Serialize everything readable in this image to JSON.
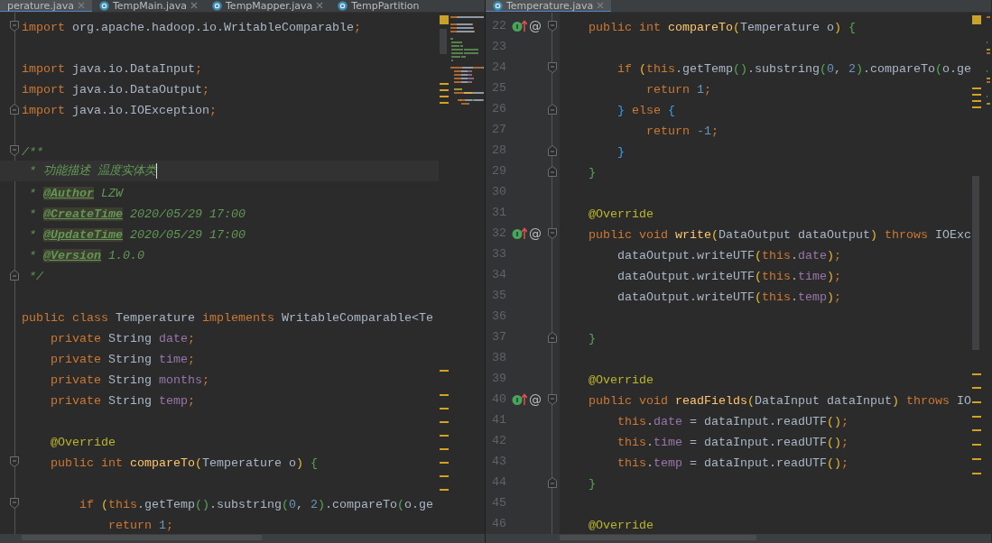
{
  "left_editor": {
    "tabs": [
      {
        "label": "perature.java",
        "selected": true,
        "icon": false,
        "closable": true
      },
      {
        "label": "TempMain.java",
        "selected": false,
        "icon": true,
        "closable": true
      },
      {
        "label": "TempMapper.java",
        "selected": false,
        "icon": true,
        "closable": true
      },
      {
        "label": "TempPartition",
        "selected": false,
        "icon": true,
        "closable": false
      }
    ],
    "lines": [
      {
        "current": false,
        "fold_start": true,
        "fold_end": false,
        "tokens": [
          {
            "text": "import ",
            "kind": "kw"
          },
          {
            "text": "org.apache.hadoop.io.WritableComparable",
            "kind": "plain"
          },
          {
            "text": ";",
            "kind": "kw"
          }
        ]
      },
      {
        "current": false,
        "fold_start": false,
        "fold_end": false
      },
      {
        "current": false,
        "fold_start": false,
        "fold_end": false,
        "tokens": [
          {
            "text": "import ",
            "kind": "kw"
          },
          {
            "text": "java.io.DataInput",
            "kind": "plain"
          },
          {
            "text": ";",
            "kind": "kw"
          }
        ]
      },
      {
        "current": false,
        "fold_start": false,
        "fold_end": false,
        "tokens": [
          {
            "text": "import ",
            "kind": "kw"
          },
          {
            "text": "java.io.DataOutput",
            "kind": "plain"
          },
          {
            "text": ";",
            "kind": "kw"
          }
        ]
      },
      {
        "current": false,
        "fold_start": false,
        "fold_end": true,
        "tokens": [
          {
            "text": "import ",
            "kind": "kw"
          },
          {
            "text": "java.io.IOException",
            "kind": "plain"
          },
          {
            "text": ";",
            "kind": "kw"
          }
        ]
      },
      {
        "current": false,
        "fold_start": false,
        "fold_end": false
      },
      {
        "current": false,
        "fold_start": true,
        "fold_end": false,
        "tokens": [
          {
            "text": "/**",
            "kind": "comment"
          }
        ]
      },
      {
        "current": true,
        "fold_start": false,
        "fold_end": false,
        "tokens": [
          {
            "text": " * 功能描述 温度实体类",
            "kind": "comment"
          }
        ]
      },
      {
        "current": false,
        "fold_start": false,
        "fold_end": false,
        "tokens": [
          {
            "text": " * ",
            "kind": "comment"
          },
          {
            "text": "@Author",
            "kind": "doctag"
          },
          {
            "text": " LZW",
            "kind": "comment"
          }
        ]
      },
      {
        "current": false,
        "fold_start": false,
        "fold_end": false,
        "tokens": [
          {
            "text": " * ",
            "kind": "comment"
          },
          {
            "text": "@CreateTime",
            "kind": "doctag"
          },
          {
            "text": " 2020/05/29 17:00",
            "kind": "comment"
          }
        ]
      },
      {
        "current": false,
        "fold_start": false,
        "fold_end": false,
        "tokens": [
          {
            "text": " * ",
            "kind": "comment"
          },
          {
            "text": "@UpdateTime",
            "kind": "doctag"
          },
          {
            "text": " 2020/05/29 17:00",
            "kind": "comment"
          }
        ]
      },
      {
        "current": false,
        "fold_start": false,
        "fold_end": false,
        "tokens": [
          {
            "text": " * ",
            "kind": "comment"
          },
          {
            "text": "@Version",
            "kind": "doctag"
          },
          {
            "text": " 1.0.0",
            "kind": "comment"
          }
        ]
      },
      {
        "current": false,
        "fold_start": false,
        "fold_end": true,
        "tokens": [
          {
            "text": " */",
            "kind": "comment"
          }
        ]
      },
      {
        "current": false,
        "fold_start": false,
        "fold_end": false
      },
      {
        "current": false,
        "fold_start": false,
        "fold_end": false,
        "tokens": [
          {
            "text": "public class ",
            "kind": "kw"
          },
          {
            "text": "Temperature ",
            "kind": "plain"
          },
          {
            "text": "implements ",
            "kind": "kw"
          },
          {
            "text": "WritableComparable<Te",
            "kind": "plain"
          }
        ]
      },
      {
        "current": false,
        "fold_start": false,
        "fold_end": false,
        "tokens": [
          {
            "text": "    private ",
            "kind": "kw"
          },
          {
            "text": "String ",
            "kind": "plain"
          },
          {
            "text": "date",
            "kind": "field"
          },
          {
            "text": ";",
            "kind": "kw"
          }
        ]
      },
      {
        "current": false,
        "fold_start": false,
        "fold_end": false,
        "tokens": [
          {
            "text": "    private ",
            "kind": "kw"
          },
          {
            "text": "String ",
            "kind": "plain"
          },
          {
            "text": "time",
            "kind": "field"
          },
          {
            "text": ";",
            "kind": "kw"
          }
        ]
      },
      {
        "current": false,
        "fold_start": false,
        "fold_end": false,
        "tokens": [
          {
            "text": "    private ",
            "kind": "kw"
          },
          {
            "text": "String ",
            "kind": "plain"
          },
          {
            "text": "months",
            "kind": "field"
          },
          {
            "text": ";",
            "kind": "kw"
          }
        ]
      },
      {
        "current": false,
        "fold_start": false,
        "fold_end": false,
        "tokens": [
          {
            "text": "    private ",
            "kind": "kw"
          },
          {
            "text": "String ",
            "kind": "plain"
          },
          {
            "text": "temp",
            "kind": "field"
          },
          {
            "text": ";",
            "kind": "kw"
          }
        ]
      },
      {
        "current": false,
        "fold_start": false,
        "fold_end": false
      },
      {
        "current": false,
        "fold_start": false,
        "fold_end": false,
        "tokens": [
          {
            "text": "    @Override",
            "kind": "annot"
          }
        ]
      },
      {
        "current": false,
        "fold_start": true,
        "fold_end": false,
        "tokens": [
          {
            "text": "    public int ",
            "kind": "kw"
          },
          {
            "text": "compareTo",
            "kind": "method"
          },
          {
            "text": "(",
            "kind": "paren1"
          },
          {
            "text": "Temperature o",
            "kind": "plain"
          },
          {
            "text": ") ",
            "kind": "paren1"
          },
          {
            "text": "{",
            "kind": "paren2"
          }
        ]
      },
      {
        "current": false,
        "fold_start": false,
        "fold_end": false
      },
      {
        "current": false,
        "fold_start": true,
        "fold_end": false,
        "tokens": [
          {
            "text": "        if ",
            "kind": "kw"
          },
          {
            "text": "(",
            "kind": "paren1"
          },
          {
            "text": "this",
            "kind": "kw"
          },
          {
            "text": ".getTemp",
            "kind": "plain"
          },
          {
            "text": "()",
            "kind": "paren2"
          },
          {
            "text": ".substring",
            "kind": "plain"
          },
          {
            "text": "(",
            "kind": "paren2"
          },
          {
            "text": "0",
            "kind": "num"
          },
          {
            "text": ", ",
            "kind": "plain"
          },
          {
            "text": "2",
            "kind": "num"
          },
          {
            "text": ")",
            "kind": "paren2"
          },
          {
            "text": ".compareTo",
            "kind": "plain"
          },
          {
            "text": "(",
            "kind": "paren2"
          },
          {
            "text": "o.ge",
            "kind": "plain"
          }
        ]
      },
      {
        "current": false,
        "fold_start": false,
        "fold_end": false,
        "tokens": [
          {
            "text": "            return ",
            "kind": "kw"
          },
          {
            "text": "1",
            "kind": "num"
          },
          {
            "text": ";",
            "kind": "kw"
          }
        ]
      }
    ]
  },
  "right_editor": {
    "tabs": [
      {
        "label": "Temperature.java",
        "selected": true,
        "icon": true,
        "closable": true
      }
    ],
    "lines": [
      {
        "number": "22",
        "gutter_mark": "@",
        "fold_start": true,
        "fold_end": false,
        "tokens": [
          {
            "text": "    public int ",
            "kind": "kw"
          },
          {
            "text": "compareTo",
            "kind": "method"
          },
          {
            "text": "(",
            "kind": "paren1"
          },
          {
            "text": "Temperature o",
            "kind": "plain"
          },
          {
            "text": ") ",
            "kind": "paren1"
          },
          {
            "text": "{",
            "kind": "paren2"
          }
        ]
      },
      {
        "number": "23",
        "fold_start": false,
        "fold_end": false
      },
      {
        "number": "24",
        "fold_start": true,
        "fold_end": false,
        "tokens": [
          {
            "text": "        if ",
            "kind": "kw"
          },
          {
            "text": "(",
            "kind": "paren1"
          },
          {
            "text": "this",
            "kind": "kw"
          },
          {
            "text": ".getTemp",
            "kind": "plain"
          },
          {
            "text": "()",
            "kind": "paren2"
          },
          {
            "text": ".substring",
            "kind": "plain"
          },
          {
            "text": "(",
            "kind": "paren2"
          },
          {
            "text": "0",
            "kind": "num"
          },
          {
            "text": ", ",
            "kind": "plain"
          },
          {
            "text": "2",
            "kind": "num"
          },
          {
            "text": ")",
            "kind": "paren2"
          },
          {
            "text": ".compareTo",
            "kind": "plain"
          },
          {
            "text": "(",
            "kind": "paren2"
          },
          {
            "text": "o.ge",
            "kind": "plain"
          }
        ]
      },
      {
        "number": "25",
        "fold_start": false,
        "fold_end": false,
        "tokens": [
          {
            "text": "            return ",
            "kind": "kw"
          },
          {
            "text": "1",
            "kind": "num"
          },
          {
            "text": ";",
            "kind": "kw"
          }
        ]
      },
      {
        "number": "26",
        "fold_start": false,
        "fold_end": true,
        "tokens": [
          {
            "text": "        }",
            "kind": "paren3"
          },
          {
            "text": " else ",
            "kind": "kw"
          },
          {
            "text": "{",
            "kind": "paren3"
          }
        ]
      },
      {
        "number": "27",
        "fold_start": false,
        "fold_end": false,
        "tokens": [
          {
            "text": "            return ",
            "kind": "kw"
          },
          {
            "text": "-1",
            "kind": "num"
          },
          {
            "text": ";",
            "kind": "kw"
          }
        ]
      },
      {
        "number": "28",
        "fold_start": false,
        "fold_end": true,
        "tokens": [
          {
            "text": "        }",
            "kind": "paren3"
          }
        ]
      },
      {
        "number": "29",
        "fold_start": false,
        "fold_end": true,
        "tokens": [
          {
            "text": "    }",
            "kind": "paren2"
          }
        ]
      },
      {
        "number": "30",
        "fold_start": false,
        "fold_end": false
      },
      {
        "number": "31",
        "fold_start": false,
        "fold_end": false,
        "tokens": [
          {
            "text": "    @Override",
            "kind": "annot"
          }
        ]
      },
      {
        "number": "32",
        "gutter_mark": "@",
        "fold_start": true,
        "fold_end": false,
        "tokens": [
          {
            "text": "    public void ",
            "kind": "kw"
          },
          {
            "text": "write",
            "kind": "method"
          },
          {
            "text": "(",
            "kind": "paren1"
          },
          {
            "text": "DataOutput dataOutput",
            "kind": "plain"
          },
          {
            "text": ")",
            "kind": "paren1"
          },
          {
            "text": " throws ",
            "kind": "kw"
          },
          {
            "text": "IOExc",
            "kind": "plain"
          }
        ]
      },
      {
        "number": "33",
        "fold_start": false,
        "fold_end": false,
        "tokens": [
          {
            "text": "        dataOutput.writeUTF",
            "kind": "plain"
          },
          {
            "text": "(",
            "kind": "paren1"
          },
          {
            "text": "this",
            "kind": "kw"
          },
          {
            "text": ".",
            "kind": "plain"
          },
          {
            "text": "date",
            "kind": "field"
          },
          {
            "text": ")",
            "kind": "paren1"
          },
          {
            "text": ";",
            "kind": "kw"
          }
        ]
      },
      {
        "number": "34",
        "fold_start": false,
        "fold_end": false,
        "tokens": [
          {
            "text": "        dataOutput.writeUTF",
            "kind": "plain"
          },
          {
            "text": "(",
            "kind": "paren1"
          },
          {
            "text": "this",
            "kind": "kw"
          },
          {
            "text": ".",
            "kind": "plain"
          },
          {
            "text": "time",
            "kind": "field"
          },
          {
            "text": ")",
            "kind": "paren1"
          },
          {
            "text": ";",
            "kind": "kw"
          }
        ]
      },
      {
        "number": "35",
        "fold_start": false,
        "fold_end": false,
        "tokens": [
          {
            "text": "        dataOutput.writeUTF",
            "kind": "plain"
          },
          {
            "text": "(",
            "kind": "paren1"
          },
          {
            "text": "this",
            "kind": "kw"
          },
          {
            "text": ".",
            "kind": "plain"
          },
          {
            "text": "temp",
            "kind": "field"
          },
          {
            "text": ")",
            "kind": "paren1"
          },
          {
            "text": ";",
            "kind": "kw"
          }
        ]
      },
      {
        "number": "36",
        "fold_start": false,
        "fold_end": false
      },
      {
        "number": "37",
        "fold_start": false,
        "fold_end": true,
        "tokens": [
          {
            "text": "    }",
            "kind": "paren2"
          }
        ]
      },
      {
        "number": "38",
        "fold_start": false,
        "fold_end": false
      },
      {
        "number": "39",
        "fold_start": false,
        "fold_end": false,
        "tokens": [
          {
            "text": "    @Override",
            "kind": "annot"
          }
        ]
      },
      {
        "number": "40",
        "gutter_mark": "@",
        "fold_start": true,
        "fold_end": false,
        "tokens": [
          {
            "text": "    public void ",
            "kind": "kw"
          },
          {
            "text": "readFields",
            "kind": "method"
          },
          {
            "text": "(",
            "kind": "paren1"
          },
          {
            "text": "DataInput dataInput",
            "kind": "plain"
          },
          {
            "text": ")",
            "kind": "paren1"
          },
          {
            "text": " throws ",
            "kind": "kw"
          },
          {
            "text": "IO",
            "kind": "plain"
          }
        ]
      },
      {
        "number": "41",
        "fold_start": false,
        "fold_end": false,
        "tokens": [
          {
            "text": "        this",
            "kind": "kw"
          },
          {
            "text": ".",
            "kind": "plain"
          },
          {
            "text": "date",
            "kind": "field"
          },
          {
            "text": " = dataInput.readUTF",
            "kind": "plain"
          },
          {
            "text": "()",
            "kind": "paren1"
          },
          {
            "text": ";",
            "kind": "kw"
          }
        ]
      },
      {
        "number": "42",
        "fold_start": false,
        "fold_end": false,
        "tokens": [
          {
            "text": "        this",
            "kind": "kw"
          },
          {
            "text": ".",
            "kind": "plain"
          },
          {
            "text": "time",
            "kind": "field"
          },
          {
            "text": " = dataInput.readUTF",
            "kind": "plain"
          },
          {
            "text": "()",
            "kind": "paren1"
          },
          {
            "text": ";",
            "kind": "kw"
          }
        ]
      },
      {
        "number": "43",
        "fold_start": false,
        "fold_end": false,
        "tokens": [
          {
            "text": "        this",
            "kind": "kw"
          },
          {
            "text": ".",
            "kind": "plain"
          },
          {
            "text": "temp",
            "kind": "field"
          },
          {
            "text": " = dataInput.readUTF",
            "kind": "plain"
          },
          {
            "text": "()",
            "kind": "paren1"
          },
          {
            "text": ";",
            "kind": "kw"
          }
        ]
      },
      {
        "number": "44",
        "fold_start": false,
        "fold_end": true,
        "tokens": [
          {
            "text": "    }",
            "kind": "paren2"
          }
        ]
      },
      {
        "number": "45",
        "fold_start": false,
        "fold_end": false
      },
      {
        "number": "46",
        "fold_start": false,
        "fold_end": false,
        "tokens": [
          {
            "text": "    @Override",
            "kind": "annot"
          }
        ]
      }
    ]
  }
}
